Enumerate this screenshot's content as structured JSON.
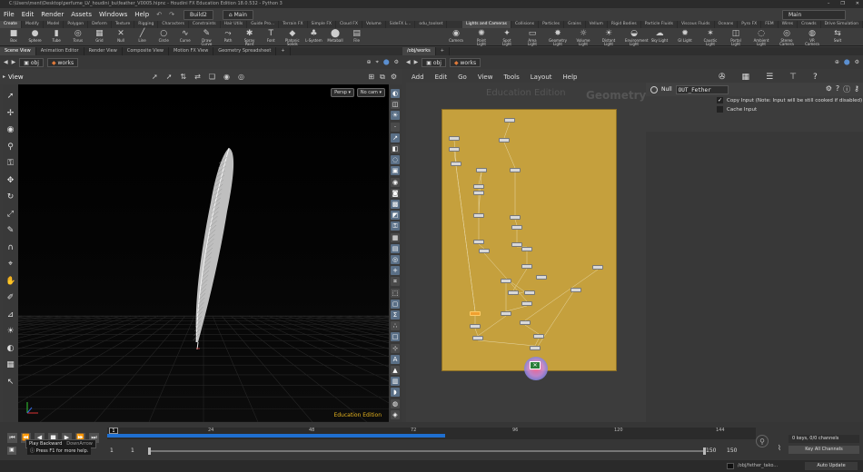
{
  "window": {
    "title": "C:\\Users\\ment\\Desktop\\perfume_LV_houdini_bu\\feather_V0005.hipnc - Houdini FX Education Edition 18.0.532 - Python 3",
    "controls": [
      "–",
      "❐",
      "✕"
    ]
  },
  "menubar": {
    "items": [
      "File",
      "Edit",
      "Render",
      "Assets",
      "Windows",
      "Help"
    ],
    "desktop_left": "Build2",
    "desktop_center": "Main",
    "desktop_right": "Main"
  },
  "shelf_tabs_left": [
    "Create",
    "Modify",
    "Model",
    "Polygon",
    "Deform",
    "Texture",
    "Rigging",
    "Characters",
    "Constraints",
    "Hair Utils",
    "Guide Pro...",
    "Terrain FX",
    "Simple FX",
    "Cloud FX",
    "Volume",
    "SideFX L...",
    "odu_toolset"
  ],
  "shelf_tabs_right": [
    "Lights and Cameras",
    "Collisions",
    "Particles",
    "Grains",
    "Vellum",
    "Rigid Bodies",
    "Particle Fluids",
    "Viscous Fluids",
    "Oceans",
    "Pyro FX",
    "FEM",
    "Wires",
    "Crowds",
    "Drive Simulation"
  ],
  "shelf_tools_left": [
    {
      "label": "Box",
      "icon": "■"
    },
    {
      "label": "Sphere",
      "icon": "●"
    },
    {
      "label": "Tube",
      "icon": "▮"
    },
    {
      "label": "Torus",
      "icon": "◎"
    },
    {
      "label": "Grid",
      "icon": "▦"
    },
    {
      "label": "Null",
      "icon": "✕"
    },
    {
      "label": "Line",
      "icon": "╱"
    },
    {
      "label": "Circle",
      "icon": "○"
    },
    {
      "label": "Curve",
      "icon": "∿"
    },
    {
      "label": "Draw Curve",
      "icon": "✎"
    },
    {
      "label": "Path",
      "icon": "⤳"
    },
    {
      "label": "Spray Paint",
      "icon": "✱"
    },
    {
      "label": "Font",
      "icon": "T"
    },
    {
      "label": "Platonic Solids",
      "icon": "◆"
    },
    {
      "label": "L-System",
      "icon": "♣"
    },
    {
      "label": "Metaball",
      "icon": "⬤"
    },
    {
      "label": "File",
      "icon": "▤"
    }
  ],
  "shelf_tools_right": [
    {
      "label": "Camera",
      "icon": "◉"
    },
    {
      "label": "Point Light",
      "icon": "✺"
    },
    {
      "label": "Spot Light",
      "icon": "✦"
    },
    {
      "label": "Area Light",
      "icon": "▭"
    },
    {
      "label": "Geometry Light",
      "icon": "✸"
    },
    {
      "label": "Volume Light",
      "icon": "☼"
    },
    {
      "label": "Distant Light",
      "icon": "☀"
    },
    {
      "label": "Environment Light",
      "icon": "◒"
    },
    {
      "label": "Sky Light",
      "icon": "☁"
    },
    {
      "label": "GI Light",
      "icon": "✹"
    },
    {
      "label": "Caustic Light",
      "icon": "✶"
    },
    {
      "label": "Portal Light",
      "icon": "◫"
    },
    {
      "label": "Ambient Light",
      "icon": "◌"
    },
    {
      "label": "Stereo Camera",
      "icon": "◎"
    },
    {
      "label": "VR Camera",
      "icon": "◍"
    },
    {
      "label": "Swit",
      "icon": "⇆"
    }
  ],
  "left_pane_tabs": [
    "Scene View",
    "Animation Editor",
    "Render View",
    "Composite View",
    "Motion FX View",
    "Geometry Spreadsheet"
  ],
  "right_pane_tabs": [
    "/obj/works"
  ],
  "left_path": {
    "root": "obj",
    "node": "works"
  },
  "right_path": {
    "root": "obj",
    "node": "works"
  },
  "viewport": {
    "label": "View",
    "persp": "Persp ▾",
    "cam": "No cam ▾",
    "watermark": "Education Edition"
  },
  "network": {
    "menu": [
      "Add",
      "Edit",
      "Go",
      "View",
      "Tools",
      "Layout",
      "Help"
    ],
    "watermark": "Education Edition",
    "context": "Geometry",
    "selected_node": "OUT_Fether"
  },
  "params": {
    "node_type": "Null",
    "node_name": "OUT_Fether",
    "copy_input_label": "Copy Input (Note: Input will be still cooked if disabled)",
    "copy_input_checked": true,
    "cache_input_label": "Cache Input",
    "cache_input_checked": false
  },
  "timeline": {
    "current_frame": "1",
    "ticks": [
      "24",
      "48",
      "72",
      "96",
      "120",
      "144"
    ],
    "start": "1",
    "start2": "1",
    "end": "150",
    "end2": "150",
    "keys_info": "0 keys, 0/0 channels",
    "key_all": "Key All Channels",
    "auto_update": "Auto Update",
    "status_path": "/obj/fether_tako...",
    "tooltip_title": "Play Backward",
    "tooltip_key": "DownArrow",
    "help_text": "Press F1 for more help."
  },
  "colors": {
    "network_bg": "#c5a03d",
    "selected_node": "#f0a030",
    "accent_blue": "#1f6fd0"
  }
}
